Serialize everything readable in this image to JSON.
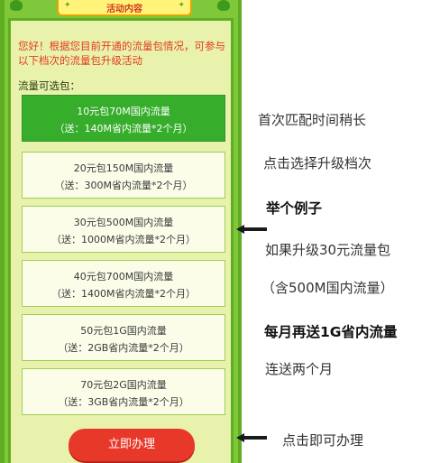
{
  "banner": {
    "title": "活动内容"
  },
  "intro": "您好！根据您目前开通的流量包情况，可参与以下档次的流量包升级活动",
  "list_label": "流量可选包：",
  "packages": [
    {
      "line1": "10元包70M国内流量",
      "line2": "（送：140M省内流量*2个月）"
    },
    {
      "line1": "20元包150M国内流量",
      "line2": "（送：300M省内流量*2个月）"
    },
    {
      "line1": "30元包500M国内流量",
      "line2": "（送：1000M省内流量*2个月）"
    },
    {
      "line1": "40元包700M国内流量",
      "line2": "（送：1400M省内流量*2个月）"
    },
    {
      "line1": "50元包1G国内流量",
      "line2": "（送：2GB省内流量*2个月）"
    },
    {
      "line1": "70元包2G国内流量",
      "line2": "（送：3GB省内流量*2个月）"
    }
  ],
  "selected_index": 0,
  "cta_label": "立即办理",
  "notes": [
    "首次匹配时间稍长",
    "点击选择升级档次",
    "举个例子",
    "如果升级30元流量包",
    "（含500M国内流量）",
    "每月再送1G省内流量",
    "连送两个月",
    "点击即可办理"
  ],
  "colors": {
    "panel_green": "#7fc73b",
    "card_bg": "#e9f2ac",
    "selected_green": "#36ad2b",
    "intro_red": "#e23b1e",
    "cta_red": "#e8382a"
  },
  "icons": [
    "tree-icon",
    "arrow-left-icon"
  ]
}
